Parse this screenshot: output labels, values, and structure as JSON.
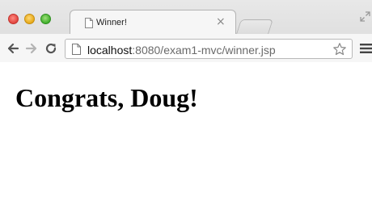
{
  "window": {
    "traffic_lights": [
      "close",
      "minimize",
      "zoom"
    ]
  },
  "tab": {
    "title": "Winner!",
    "close_glyph": "×",
    "icon": "page-icon"
  },
  "toolbar": {
    "back_icon": "arrow-left-icon",
    "forward_icon": "arrow-right-icon",
    "reload_icon": "reload-icon",
    "bookmark_icon": "star-icon",
    "menu_icon": "hamburger-menu-icon"
  },
  "address_bar": {
    "host": "localhost",
    "rest": ":8080/exam1-mvc/winner.jsp"
  },
  "page": {
    "heading": "Congrats, Doug!"
  }
}
